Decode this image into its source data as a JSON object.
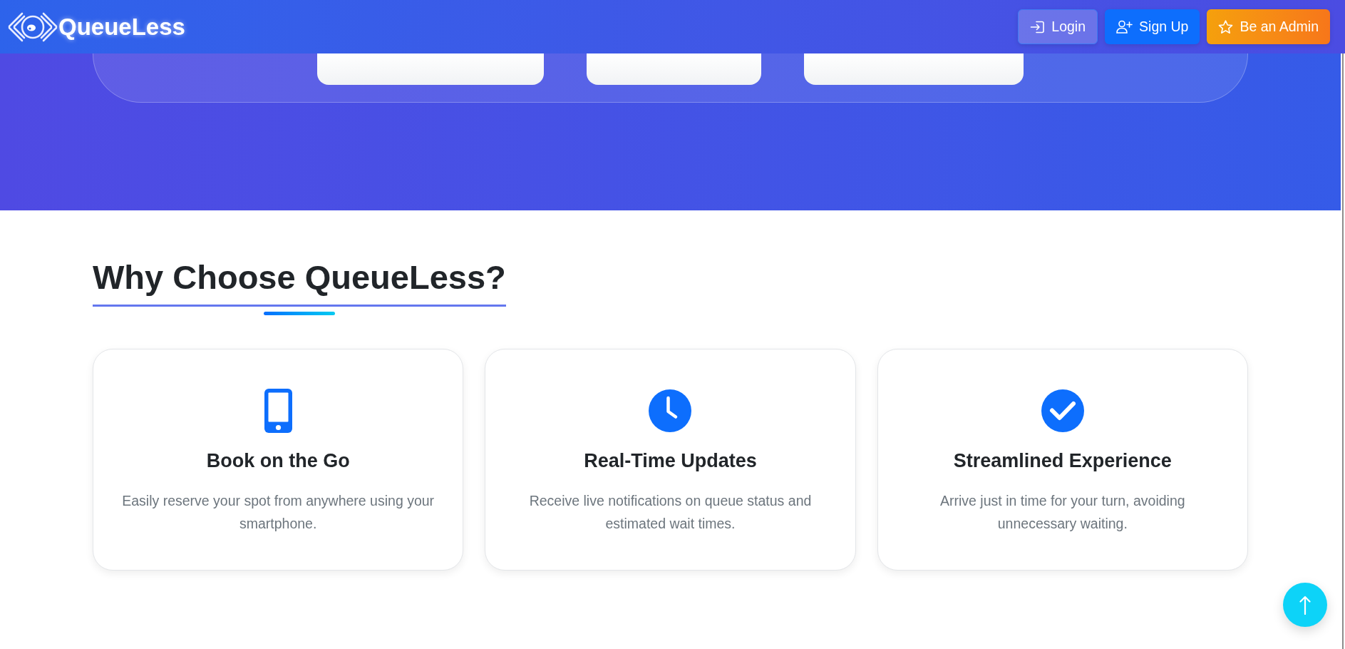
{
  "header": {
    "brand": "QueueLess",
    "buttons": [
      {
        "label": "Login",
        "kind": "outline"
      },
      {
        "label": "Sign Up",
        "kind": "primary"
      },
      {
        "label": "Be an Admin",
        "kind": "warning"
      }
    ]
  },
  "features": {
    "title": "Why Choose QueueLess?",
    "cards": [
      {
        "title": "Book on the Go",
        "text": "Easily reserve your spot from anywhere using your smartphone."
      },
      {
        "title": "Real-Time Updates",
        "text": "Receive live notifications on queue status and estimated wait times."
      },
      {
        "title": "Streamlined Experience",
        "text": "Arrive just in time for your turn, avoiding unnecessary waiting."
      }
    ]
  }
}
